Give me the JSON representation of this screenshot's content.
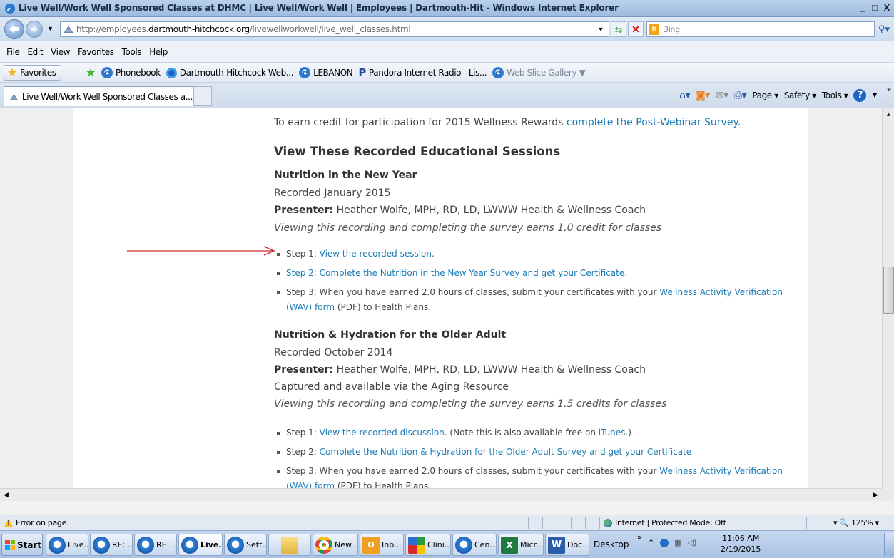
{
  "window": {
    "title": "Live Well/Work Well Sponsored Classes at DHMC | Live Well/Work Well | Employees | Dartmouth-Hit - Windows Internet Explorer",
    "controls": [
      "_",
      "□",
      "X"
    ]
  },
  "address": {
    "url_prefix": "http://employees.",
    "url_domain": "dartmouth-hitchcock.org",
    "url_path": "/livewellworkwell/live_well_classes.html",
    "search_placeholder": "Bing"
  },
  "menu": [
    "File",
    "Edit",
    "View",
    "Favorites",
    "Tools",
    "Help"
  ],
  "favorites": {
    "button_label": "Favorites",
    "items": [
      {
        "label": "Phonebook",
        "icon": "ie-icon"
      },
      {
        "label": "Dartmouth-Hitchcock Web...",
        "icon": "dh-icon"
      },
      {
        "label": "LEBANON",
        "icon": "ie-icon"
      },
      {
        "label": "Pandora Internet Radio - Lis...",
        "icon": "p-icon"
      },
      {
        "label": "Web Slice Gallery ▼",
        "icon": "ie-icon"
      }
    ]
  },
  "tab": {
    "label": "Live Well/Work Well Sponsored Classes a..."
  },
  "commands": {
    "page": "Page ▾",
    "safety": "Safety ▾",
    "tools": "Tools ▾",
    "help": "?"
  },
  "content": {
    "intro_text": "To earn credit for participation for 2015 Wellness Rewards ",
    "intro_link": "complete the Post-Webinar Survey",
    "intro_end": ".",
    "section_heading": "View These Recorded Educational Sessions",
    "session1": {
      "title": "Nutrition in the New Year",
      "recorded": "Recorded January 2015",
      "presenter_label": "Presenter:",
      "presenter": " Heather Wolfe, MPH, RD, LD, LWWW Health & Wellness Coach",
      "credit_note": "Viewing this recording and completing the survey earns 1.0 credit for classes",
      "step1_prefix": "Step 1: ",
      "step1_link": "View the recorded session.",
      "step2_link": "Step 2: Complete the Nutrition in the New Year Survey and get your Certificate.",
      "step3_text": "Step 3: When you have earned 2.0 hours of classes, submit your certificates with your ",
      "step3_link1": "Wellness Activity Verification",
      "step3_link2": "(WAV) form",
      "step3_end": " (PDF) to Health Plans."
    },
    "session2": {
      "title": "Nutrition & Hydration for the Older Adult",
      "recorded": "Recorded October 2014",
      "presenter_label": "Presenter:",
      "presenter": " Heather Wolfe, MPH, RD, LD, LWWW Health & Wellness Coach",
      "availability": "Captured and available via the Aging Resource",
      "credit_note": "Viewing this recording and completing the survey earns 1.5 credits for classes",
      "step1_prefix": "Step 1: ",
      "step1_link": "View the recorded discussion",
      "step1_mid": ". (Note this is also available free on ",
      "step1_itunes": "iTunes",
      "step1_end": ".)",
      "step2_prefix": "Step 2: ",
      "step2_link": "Complete the Nutrition & Hydration for the Older Adult Survey and get your Certificate",
      "step3_text": "Step 3: When you have earned 2.0 hours of classes, submit your certificates with your ",
      "step3_link1": "Wellness Activity Verification",
      "step3_link2": "(WAV) form",
      "step3_end": " (PDF) to Health Plans."
    }
  },
  "status": {
    "error": "Error on page.",
    "zone": "Internet | Protected Mode: Off",
    "zoom": "▾  🔍 125%  ▾"
  },
  "taskbar": {
    "start": "Start",
    "buttons": [
      {
        "label": "Live...",
        "icon": "ie"
      },
      {
        "label": "RE: ...",
        "icon": "ie"
      },
      {
        "label": "RE: ...",
        "icon": "ie"
      },
      {
        "label": "Live...",
        "icon": "ie",
        "active": true
      },
      {
        "label": "Sett...",
        "icon": "ie"
      },
      {
        "label": "",
        "icon": "folder"
      },
      {
        "label": "New...",
        "icon": "chrome"
      },
      {
        "label": "Inb...",
        "icon": "outlook"
      },
      {
        "label": "Clini...",
        "icon": "clini"
      },
      {
        "label": "Cen...",
        "icon": "ie"
      },
      {
        "label": "Micr...",
        "icon": "excel"
      },
      {
        "label": "Doc...",
        "icon": "word"
      }
    ],
    "desktop": "Desktop",
    "time": "11:06 AM",
    "date": "2/19/2015"
  },
  "colors": {
    "link": "#1a7bb5",
    "arrow": "#c8282b",
    "title_bar": "#9dbbe0"
  }
}
